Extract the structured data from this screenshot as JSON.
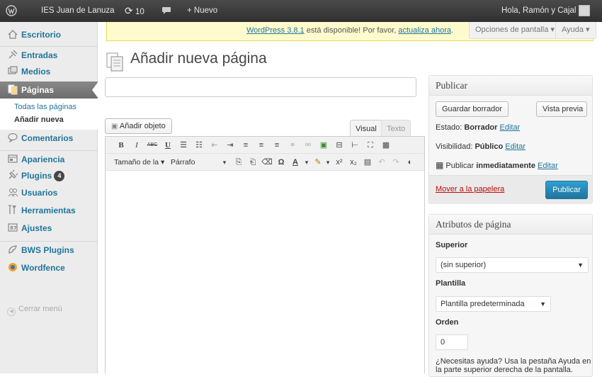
{
  "adminbar": {
    "site_name": "IES Juan de Lanuza",
    "updates_count": "10",
    "new_label": "+ Nuevo",
    "greeting": "Hola, Ramón y Cajal"
  },
  "sidebar": {
    "items": [
      {
        "label": "Escritorio"
      },
      {
        "label": "Entradas"
      },
      {
        "label": "Medios"
      },
      {
        "label": "Páginas"
      },
      {
        "label": "Comentarios"
      },
      {
        "label": "Apariencia"
      },
      {
        "label": "Plugins"
      },
      {
        "label": "Usuarios"
      },
      {
        "label": "Herramientas"
      },
      {
        "label": "Ajustes"
      },
      {
        "label": "BWS Plugins"
      },
      {
        "label": "Wordfence"
      }
    ],
    "plugins_badge": "4",
    "submenu": [
      "Todas las páginas",
      "Añadir nueva"
    ],
    "collapse_label": "Cerrar menú"
  },
  "notice": {
    "link_version": "WordPress 3.8.1",
    "middle": " está disponible! Por favor, ",
    "link_update": "actualiza ahora",
    "end": "."
  },
  "screen_options": "Opciones de pantalla ▾",
  "help": "Ayuda ▾",
  "page_title": "Añadir nueva página",
  "editor": {
    "add_media": "Añadir objeto",
    "tab_visual": "Visual",
    "tab_text": "Texto",
    "font_size": "Tamaño de la",
    "format": "Párrafo"
  },
  "publish_box": {
    "title": "Publicar",
    "save_draft": "Guardar borrador",
    "preview": "Vista previa",
    "status_label": "Estado: ",
    "status_value": "Borrador",
    "visibility_label": "Visibilidad: ",
    "visibility_value": "Público",
    "edit": "Editar",
    "publish_prefix": "Publicar ",
    "publish_value": "inmediatamente",
    "trash": "Mover a la papelera",
    "publish_button": "Publicar"
  },
  "attributes_box": {
    "title": "Atributos de página",
    "parent_label": "Superior",
    "parent_value": "(sin superior)",
    "template_label": "Plantilla",
    "template_value": "Plantilla predeterminada",
    "order_label": "Orden",
    "order_value": "0",
    "help_line1": "¿Necesitas ayuda? Usa la pestaña Ayuda en",
    "help_line2": "la parte superior derecha de la pantalla."
  },
  "colors": {
    "link": "#21759b",
    "adminbar": "#464646",
    "publish_button": "#21759b",
    "notice_bg": "#fffbcc",
    "trash": "#bc0b0b"
  }
}
